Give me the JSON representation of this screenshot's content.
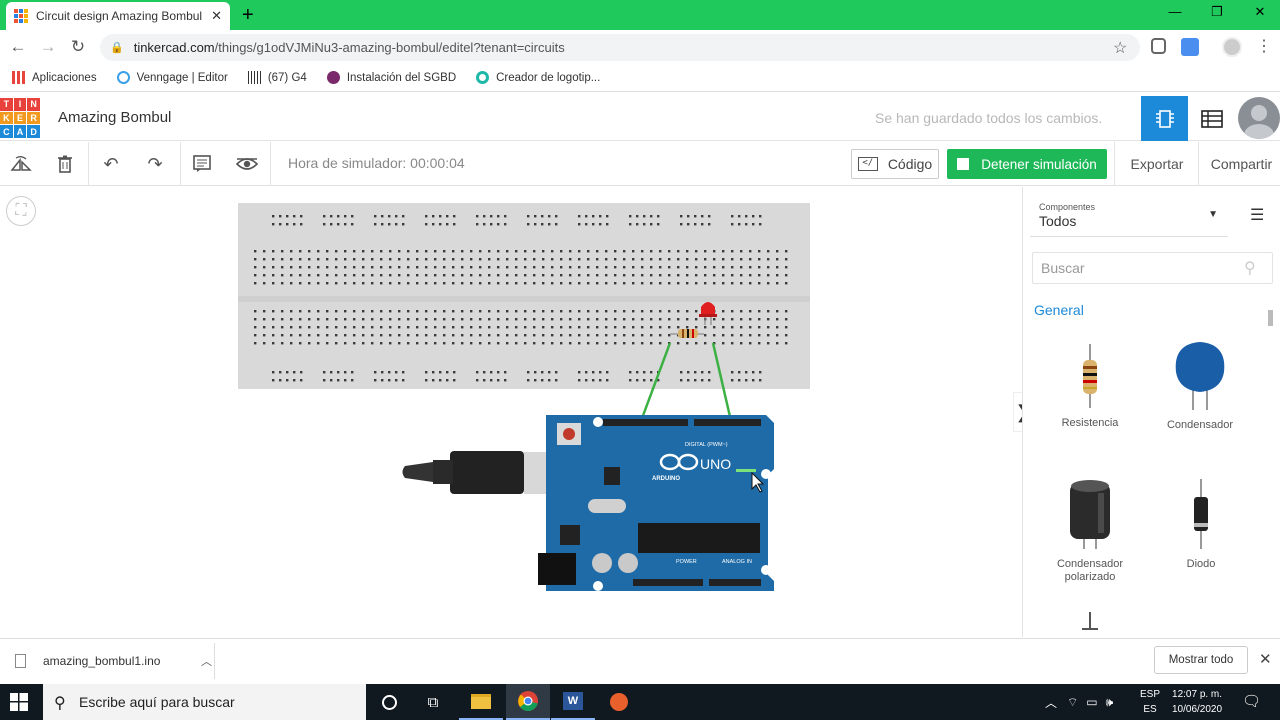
{
  "browser": {
    "tab_title": "Circuit design Amazing Bombul |",
    "tab_close": "✕",
    "new_tab": "+",
    "window_controls": [
      "—",
      "❐",
      "✕"
    ],
    "url_domain": "tinkercad.com",
    "url_path": "/things/g1odVJMiNu3-amazing-bombul/editel?tenant=circuits",
    "bookmarks": [
      {
        "label": "Aplicaciones",
        "icon": "apps-grid-icon",
        "color": "#e8453c"
      },
      {
        "label": "Venngage | Editor",
        "icon": "venngage-icon",
        "color": "#3aa0e8"
      },
      {
        "label": "(67) G4",
        "icon": "barcode-icon",
        "color": "#333333"
      },
      {
        "label": "Instalación del SGBD",
        "icon": "sgbd-icon",
        "color": "#7a2a6a"
      },
      {
        "label": "Creador de logotip...",
        "icon": "logo-maker-icon",
        "color": "#1fb8a8"
      }
    ]
  },
  "app": {
    "logo_letters": [
      "T",
      "I",
      "N",
      "K",
      "E",
      "R",
      "C",
      "A",
      "D"
    ],
    "logo_colors": [
      "#e8403a",
      "#e8403a",
      "#e8403a",
      "#f29a1f",
      "#f29a1f",
      "#f29a1f",
      "#1c8ad9",
      "#1c8ad9",
      "#1c8ad9"
    ],
    "project_name": "Amazing Bombul",
    "save_status": "Se han guardado todos los cambios.",
    "accent": "#1c8ad9"
  },
  "toolbar": {
    "sim_time": "Hora de simulador: 00:00:04",
    "code_label": "Código",
    "stop_label": "Detener simulación",
    "export_label": "Exportar",
    "share_label": "Compartir",
    "stop_color": "#1fb859"
  },
  "panel": {
    "components_label": "Componentes",
    "components_value": "Todos",
    "search_placeholder": "Buscar",
    "section": "General",
    "items": [
      {
        "label": "Resistencia",
        "icon": "resistor-icon"
      },
      {
        "label": "Condensador",
        "icon": "capacitor-icon"
      },
      {
        "label": "Condensador polarizado",
        "icon": "polarized-capacitor-icon"
      },
      {
        "label": "Diodo",
        "icon": "diode-icon"
      }
    ]
  },
  "canvas": {
    "board_label": "UNO",
    "board_brand": "ARDUINO",
    "digital_label": "DIGITAL (PWM~)",
    "power_label": "POWER",
    "analog_label": "ANALOG IN",
    "led_color": "#e02020",
    "wire_color": "#3bb143"
  },
  "downloads": {
    "file_name": "amazing_bombul1.ino",
    "show_all": "Mostrar todo"
  },
  "taskbar": {
    "search_text": "Escribe aquí para buscar",
    "lang_top": "ESP",
    "lang_bottom": "ES",
    "time": "12:07 p. m.",
    "date": "10/06/2020"
  }
}
